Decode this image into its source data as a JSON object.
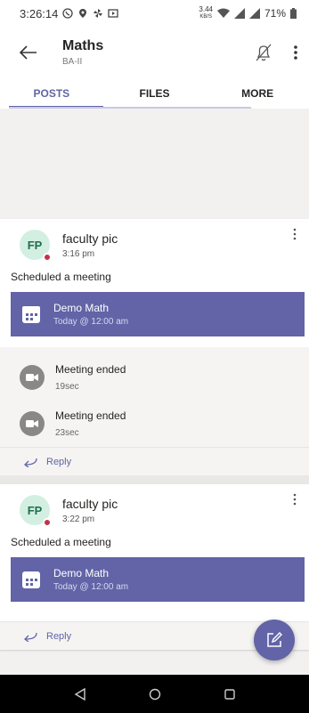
{
  "status_bar": {
    "time": "3:26:14",
    "net_speed_value": "3.44",
    "net_speed_unit": "KB/S",
    "battery": "71%"
  },
  "header": {
    "title": "Maths",
    "subtitle": "BA-II",
    "icons": [
      "back-arrow-icon",
      "notifications-off-icon",
      "more-vert-icon"
    ]
  },
  "tabs": [
    {
      "label": "POSTS",
      "active": true
    },
    {
      "label": "FILES",
      "active": false
    },
    {
      "label": "MORE",
      "active": false
    }
  ],
  "posts": [
    {
      "avatar": "FP",
      "author": "faculty pic",
      "time": "3:16 pm",
      "text": "Scheduled a meeting",
      "meeting": {
        "title": "Demo Math",
        "time": "Today @ 12:00 am"
      },
      "ended": [
        {
          "title": "Meeting ended",
          "duration": "19sec"
        },
        {
          "title": "Meeting ended",
          "duration": "23sec"
        }
      ],
      "reply_label": "Reply"
    },
    {
      "avatar": "FP",
      "author": "faculty pic",
      "time": "3:22 pm",
      "text": "Scheduled a meeting",
      "meeting": {
        "title": "Demo Math",
        "time": "Today @ 12:00 am"
      },
      "reply_label": "Reply"
    }
  ],
  "colors": {
    "accent": "#6264a7",
    "presence_busy": "#c4314b",
    "avatar_bg": "#d3efe2"
  }
}
